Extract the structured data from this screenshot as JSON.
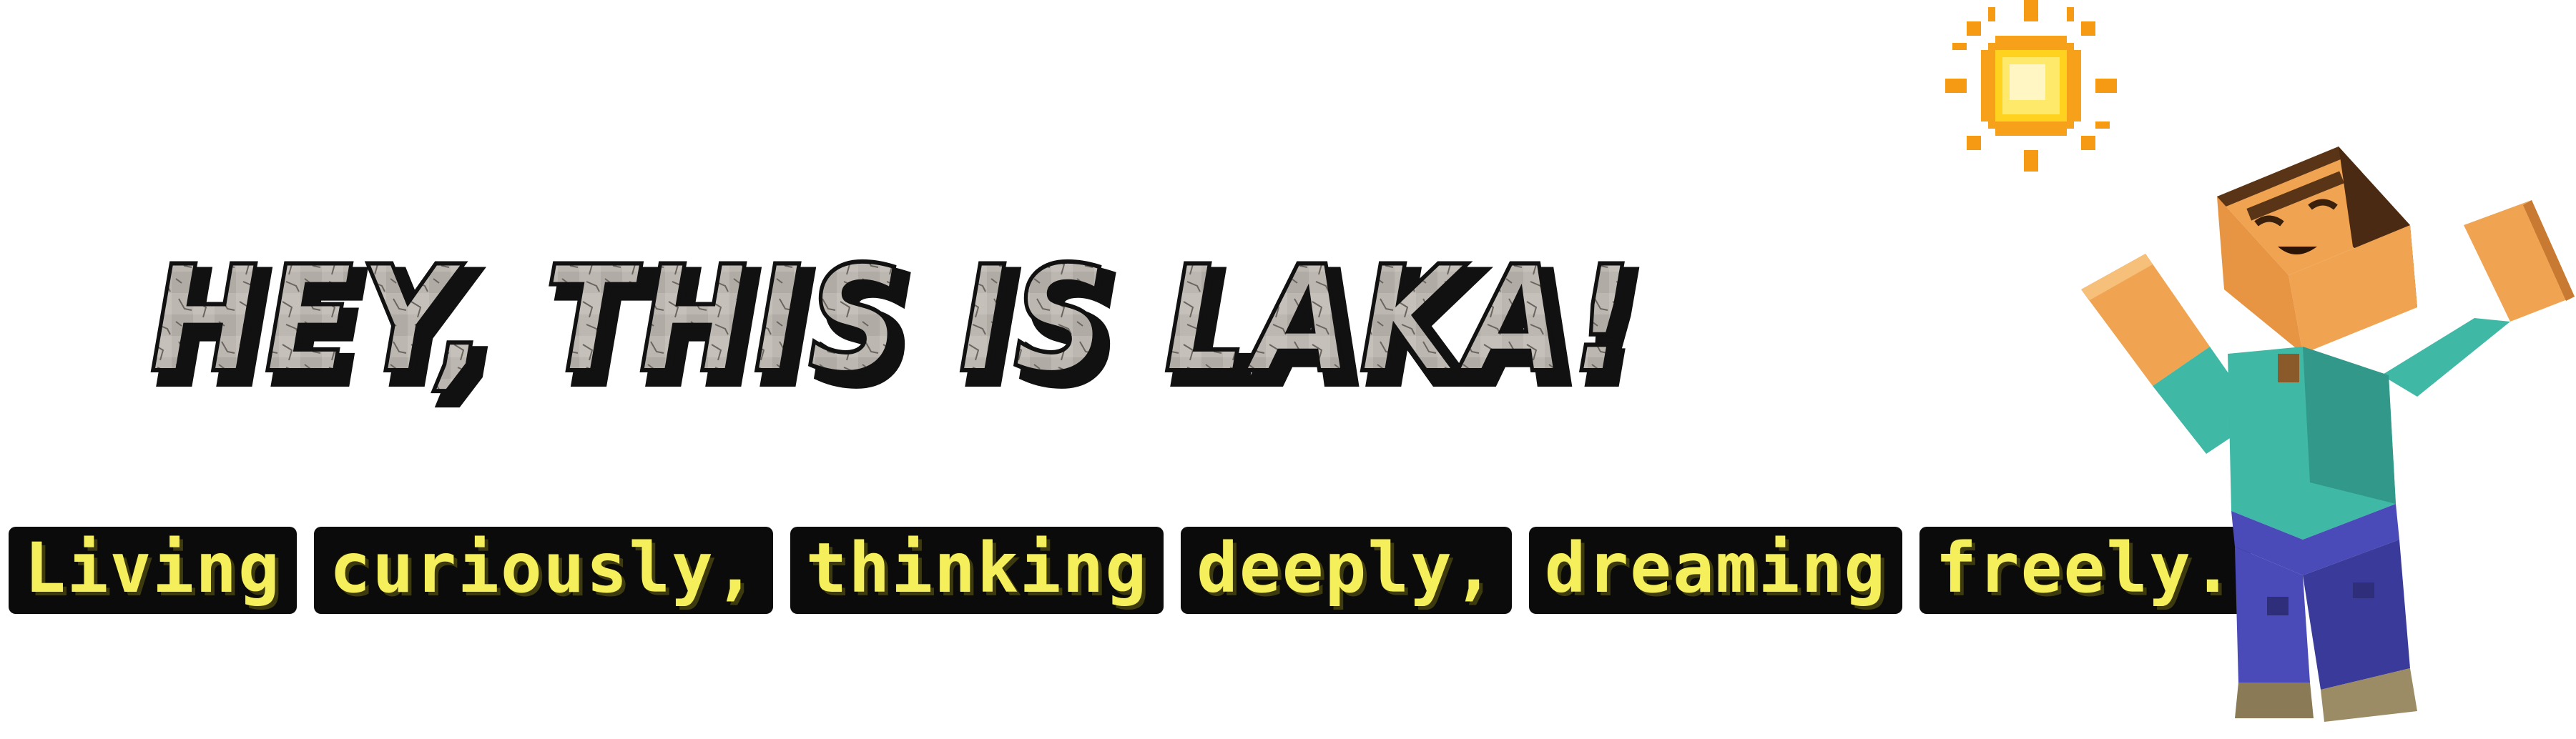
{
  "banner": {
    "title": "HEY, THIS IS LAKA!",
    "subtitle_words": [
      "Living",
      "curiously,",
      "thinking",
      "deeply,",
      "dreaming",
      "freely."
    ]
  },
  "colors": {
    "title_fill": "#b9b3ae",
    "title_outline": "#111111",
    "title_crack": "#6b6560",
    "subtitle_text": "#f4ef5a",
    "subtitle_tile": "#0b0b0b",
    "sun_core": "#ffd21f",
    "sun_ray": "#f59a12",
    "character_skin": "#f0a452",
    "character_hair": "#5a3417",
    "character_shirt": "#3fb8a6",
    "character_pants": "#4a4ab8",
    "character_boots": "#8a7a55"
  },
  "icons": {
    "sun": "pixel-sun-icon",
    "character": "blocky-character-illustration"
  }
}
